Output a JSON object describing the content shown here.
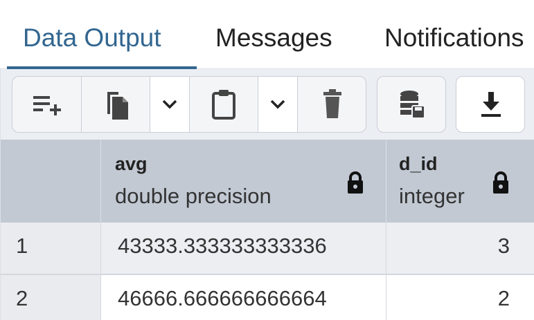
{
  "tabs": [
    {
      "label": "Data Output",
      "active": true
    },
    {
      "label": "Messages",
      "active": false
    },
    {
      "label": "Notifications",
      "active": false
    }
  ],
  "toolbar": {
    "buttons": [
      {
        "name": "add-row-button",
        "icon": "add-row-icon"
      },
      {
        "name": "copy-button",
        "icon": "copy-icon"
      },
      {
        "name": "copy-options-dropdown",
        "icon": "chevron-down-icon"
      },
      {
        "name": "paste-button",
        "icon": "clipboard-icon"
      },
      {
        "name": "paste-options-dropdown",
        "icon": "chevron-down-icon"
      },
      {
        "name": "delete-button",
        "icon": "trash-icon"
      },
      {
        "name": "save-data-button",
        "icon": "save-data-icon"
      },
      {
        "name": "download-button",
        "icon": "download-icon"
      }
    ]
  },
  "grid": {
    "columns": [
      {
        "name": "avg",
        "type": "double precision",
        "locked": true
      },
      {
        "name": "d_id",
        "type": "integer",
        "locked": true
      }
    ],
    "rows": [
      {
        "number": "1",
        "avg": "43333.333333333336",
        "d_id": "3"
      },
      {
        "number": "2",
        "avg": "46666.666666666664",
        "d_id": "2"
      }
    ]
  },
  "colors": {
    "accent": "#326690",
    "header_bg": "#c2c9d3",
    "toolbar_bg": "#ebeef3"
  }
}
